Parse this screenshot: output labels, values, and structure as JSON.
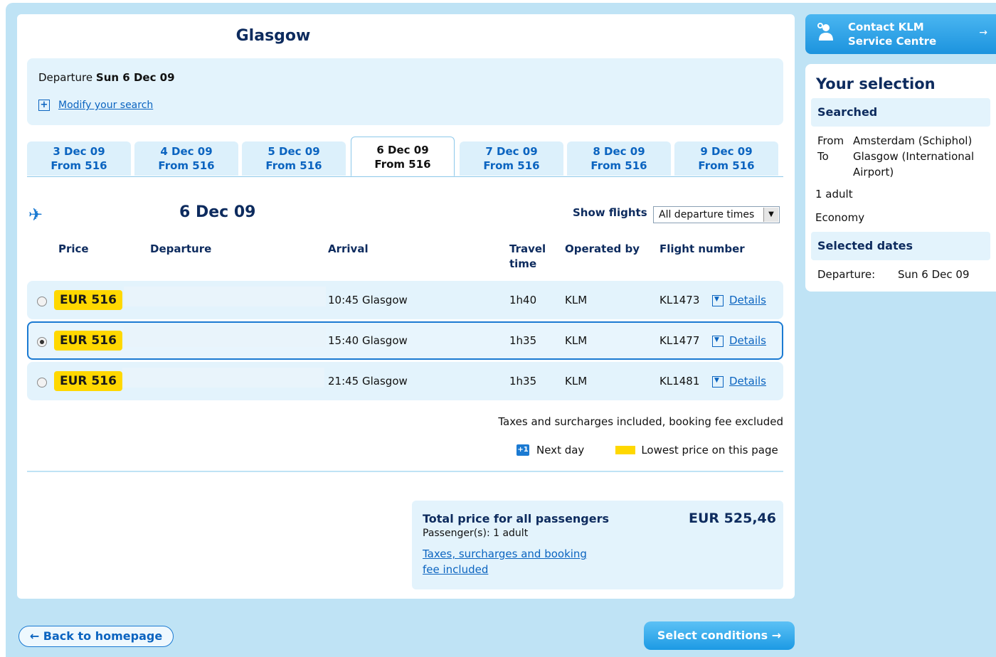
{
  "page_title": "Glasgow",
  "search": {
    "departure_label": "Departure",
    "departure_value": "Sun 6 Dec 09",
    "modify_link": "Modify your search",
    "plus_glyph": "+"
  },
  "date_tabs": [
    {
      "date": "3 Dec 09",
      "from": "From  516"
    },
    {
      "date": "4 Dec 09",
      "from": "From  516"
    },
    {
      "date": "5 Dec 09",
      "from": "From  516"
    },
    {
      "date": "6 Dec 09",
      "from": "From  516",
      "active": true
    },
    {
      "date": "7 Dec 09",
      "from": "From  516"
    },
    {
      "date": "8 Dec 09",
      "from": "From  516"
    },
    {
      "date": "9 Dec 09",
      "from": "From  516"
    }
  ],
  "flights_header": {
    "date": "6 Dec 09",
    "show_flights_label": "Show flights",
    "show_flights_selected": "All departure times",
    "plane_icon": "plane-icon"
  },
  "columns": {
    "price": "Price",
    "departure": "Departure",
    "arrival": "Arrival",
    "travel_time_1": "Travel",
    "travel_time_2": "time",
    "operated_by": "Operated by",
    "flight_number": "Flight number"
  },
  "flights": [
    {
      "price": "EUR 516",
      "arrival": "10:45 Glasgow",
      "travel_time": "1h40",
      "operator": "KLM",
      "flight_number": "KL1473",
      "details": "Details",
      "selected": false
    },
    {
      "price": "EUR 516",
      "arrival": "15:40 Glasgow",
      "travel_time": "1h35",
      "operator": "KLM",
      "flight_number": "KL1477",
      "details": "Details",
      "selected": true
    },
    {
      "price": "EUR 516",
      "arrival": "21:45 Glasgow",
      "travel_time": "1h35",
      "operator": "KLM",
      "flight_number": "KL1481",
      "details": "Details",
      "selected": false
    }
  ],
  "tax_note": "Taxes and surcharges included, booking fee excluded",
  "legend": {
    "next_day_badge": "+1",
    "next_day": "Next day",
    "lowest_price": "Lowest price on this page"
  },
  "total": {
    "label": "Total price for all passengers",
    "passengers": "Passenger(s): 1 adult",
    "taxes_link": "Taxes, surcharges and booking fee included",
    "amount": "EUR 525,46"
  },
  "buttons": {
    "back": "← Back to homepage",
    "select_conditions": "Select conditions  →"
  },
  "contact": {
    "line1": "Contact KLM",
    "line2": "Service Centre",
    "arrow": "→"
  },
  "selection": {
    "title": "Your selection",
    "searched_header": "Searched",
    "from_label": "From",
    "from_value": "Amsterdam (Schiphol)",
    "to_label": "To",
    "to_value": "Glasgow (International Airport)",
    "passengers": "1 adult",
    "cabin": "Economy",
    "dates_header": "Selected dates",
    "departure_label": "Departure:",
    "departure_value": "Sun 6 Dec 09"
  },
  "colors": {
    "background": "#bfe3f5",
    "accent_blue": "#1b7ad2",
    "lowest_price_yellow": "#ffd800",
    "panel_light": "#e3f3fc"
  }
}
